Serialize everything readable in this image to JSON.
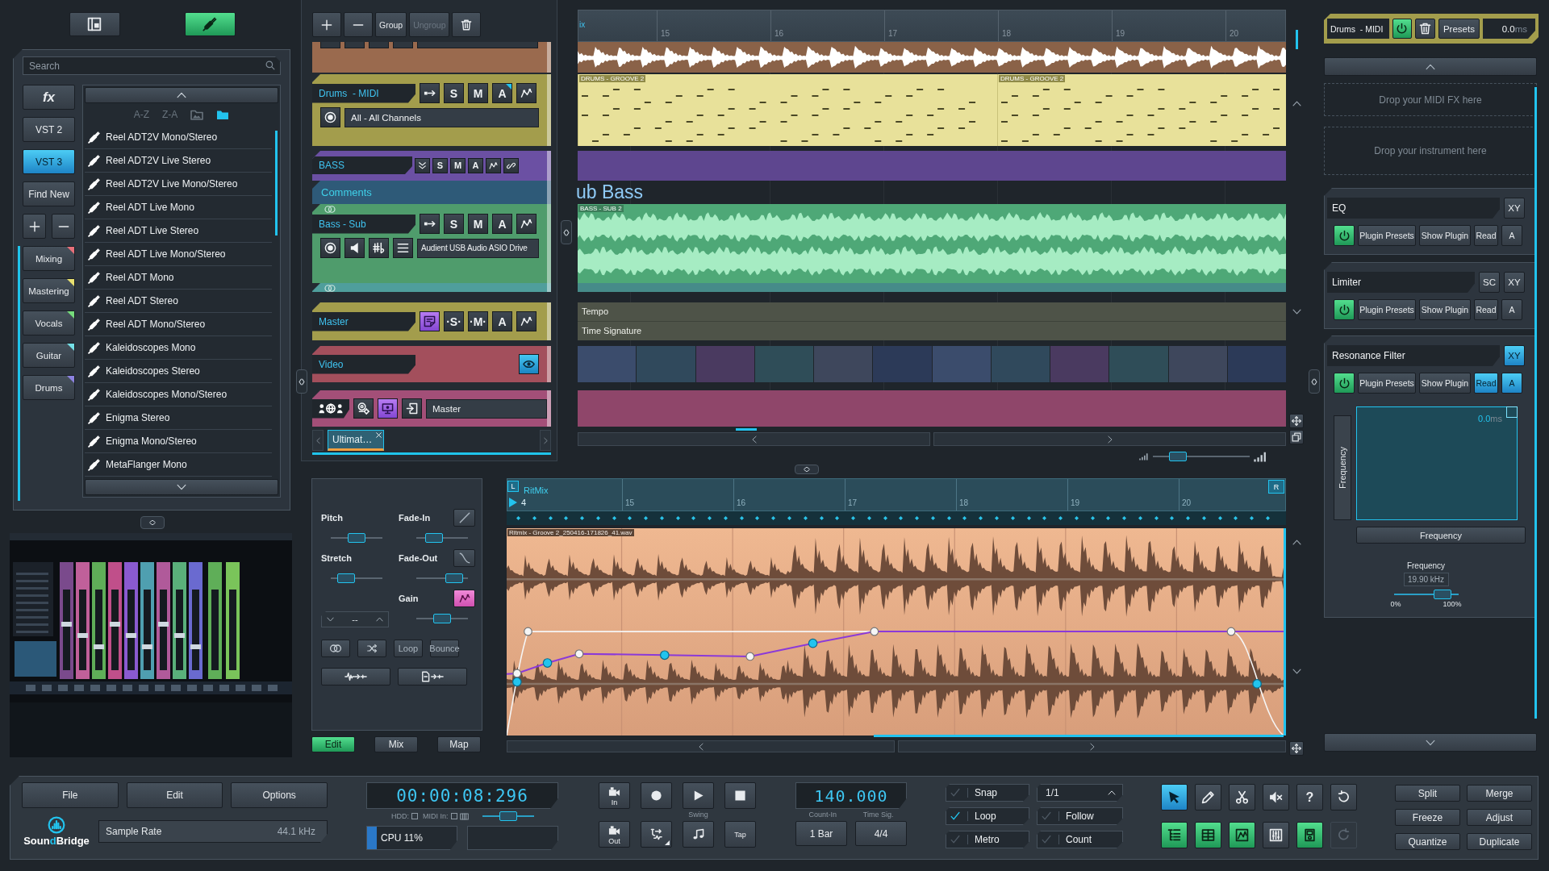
{
  "sidebar": {
    "view_tabs": [
      {
        "kind": "layout",
        "selected": false
      },
      {
        "kind": "plugins",
        "selected": true
      }
    ],
    "search": {
      "placeholder": "Search"
    },
    "formats": [
      {
        "kind": "fx",
        "label": "fx",
        "selected": false
      },
      {
        "kind": "text",
        "label": "VST 2",
        "selected": false
      },
      {
        "kind": "text",
        "label": "VST 3",
        "selected": true
      },
      {
        "kind": "text",
        "label": "Find New",
        "selected": false
      }
    ],
    "collections": [
      {
        "label": "Mixing",
        "color": "#e8707a"
      },
      {
        "label": "Mastering",
        "color": "#e8e070"
      },
      {
        "label": "Vocals",
        "color": "#76dc7c"
      },
      {
        "label": "Guitar",
        "color": "#74dfe6"
      },
      {
        "label": "Drums",
        "color": "#8c82e0"
      }
    ],
    "sort": [
      {
        "label": "A-Z",
        "selected": false
      },
      {
        "label": "Z-A",
        "selected": false
      }
    ],
    "filters": [
      {
        "selected": false
      },
      {
        "selected": true
      }
    ],
    "plugins": [
      "Reel ADT2V Mono/Stereo",
      "Reel ADT2V Live Stereo",
      "Reel ADT2V Live Mono/Stereo",
      "Reel ADT Live Mono",
      "Reel ADT Live Stereo",
      "Reel ADT Live Mono/Stereo",
      "Reel ADT Mono",
      "Reel ADT Stereo",
      "Reel ADT Mono/Stereo",
      "Kaleidoscopes Mono",
      "Kaleidoscopes Stereo",
      "Kaleidoscopes Mono/Stereo",
      "Enigma Stereo",
      "Enigma Mono/Stereo",
      "MetaFlanger Mono"
    ]
  },
  "tracks_panel": {
    "actions": [
      {
        "label": "Group",
        "disabled": false
      },
      {
        "label": "Ungroup",
        "disabled": true
      }
    ],
    "tracks": [
      {
        "kind": "tail",
        "color": "#9a6a4e"
      },
      {
        "kind": "instrument",
        "name": "Drums  - MIDI",
        "color": "#a39d4c",
        "buttons": [
          {
            "label": "S",
            "marked": false
          },
          {
            "label": "M",
            "marked": false
          },
          {
            "label": "A",
            "marked": true
          }
        ],
        "input": "All - All Channels",
        "lane": {
          "clips": [
            "DRUMS - GROOVE 2",
            "DRUMS - GROOVE 2"
          ]
        }
      },
      {
        "kind": "folder",
        "name": "BASS",
        "color": "#6b50a3",
        "buttons": [
          {
            "label": "S",
            "marked": false
          },
          {
            "label": "M",
            "marked": false
          },
          {
            "label": "A",
            "marked": false
          }
        ]
      },
      {
        "kind": "comment",
        "name": "Comments",
        "color": "#2e5a78",
        "lane": {
          "text": "ub Bass"
        }
      },
      {
        "kind": "audio",
        "name": "Bass - Sub",
        "color": "#4f9c6c",
        "buttons": [
          {
            "label": "S",
            "marked": false
          },
          {
            "label": "M",
            "marked": false
          },
          {
            "label": "A",
            "marked": false
          }
        ],
        "input": "Audient USB Audio ASIO Drive",
        "lane": {
          "clips": [
            "BASS - SUB 2"
          ]
        }
      },
      {
        "kind": "head",
        "color": "#4f9e9c"
      },
      {
        "kind": "master",
        "name": "Master",
        "color": "#a39d4c",
        "toggle_on": true,
        "buttons": [
          {
            "label": "·S·",
            "marked": false
          },
          {
            "label": "·M·",
            "marked": false
          },
          {
            "label": "A",
            "marked": false
          }
        ],
        "lane": {
          "labels": [
            "Tempo",
            "Time Signature"
          ]
        }
      },
      {
        "kind": "video",
        "name": "Video",
        "color": "#a34f5c",
        "toggle_on": true
      },
      {
        "kind": "collab",
        "color": "#a34f78",
        "toggle_on": true,
        "input": "Master"
      }
    ],
    "tabs": [
      {
        "label": "Ultimat…",
        "selected": true
      }
    ]
  },
  "arrangement": {
    "ruler_label": "ix",
    "ruler": [
      "15",
      "16",
      "17",
      "18",
      "19",
      "20"
    ],
    "zoom": {
      "level": 0.2
    }
  },
  "clip_editor": {
    "left_controls": [
      {
        "label": "Pitch",
        "level": 0.5
      },
      {
        "label": "Stretch",
        "level": 0.2
      }
    ],
    "right_controls": [
      {
        "label": "Fade-In",
        "kind": "fade-in",
        "active": false,
        "level": 0.25
      },
      {
        "label": "Fade-Out",
        "kind": "fade-out",
        "active": false,
        "level": 0.85
      },
      {
        "label": "Gain",
        "kind": "gain",
        "active": true,
        "level": 0.5
      }
    ],
    "mode": "--",
    "buttons": [
      "Loop",
      "Bounce"
    ],
    "tabs": [
      {
        "label": "Edit",
        "selected": true
      },
      {
        "label": "Mix",
        "selected": false
      },
      {
        "label": "Map",
        "selected": false
      }
    ],
    "region": {
      "start_marker": "L",
      "title": "RitMix",
      "bar": "4",
      "end_marker": "R",
      "ruler": [
        "15",
        "16",
        "17",
        "18",
        "19",
        "20"
      ],
      "clip": "Ritmix - Groove 2_250416-171826_41.wav"
    }
  },
  "inspector": {
    "track": "Drums  - MIDI",
    "power": true,
    "presets": "Presets",
    "delay": "0.0",
    "delay_unit": "ms",
    "drop_zones": [
      "Drop your MIDI FX here",
      "Drop your instrument here"
    ],
    "plugins": [
      {
        "name": "EQ",
        "on": true,
        "toggles": [
          {
            "label": "XY",
            "selected": false
          }
        ],
        "actions": [
          {
            "label": "Plugin Presets",
            "selected": false
          },
          {
            "label": "Show Plugin",
            "selected": false
          },
          {
            "label": "Read",
            "selected": false
          },
          {
            "label": "A",
            "selected": false
          }
        ]
      },
      {
        "name": "Limiter",
        "on": true,
        "toggles": [
          {
            "label": "SC",
            "selected": false
          },
          {
            "label": "XY",
            "selected": false
          }
        ],
        "actions": [
          {
            "label": "Plugin Presets",
            "selected": false
          },
          {
            "label": "Show Plugin",
            "selected": false
          },
          {
            "label": "Read",
            "selected": false
          },
          {
            "label": "A",
            "selected": false
          }
        ]
      },
      {
        "name": "Resonance Filter",
        "on": true,
        "toggles": [
          {
            "label": "XY",
            "selected": true
          }
        ],
        "actions": [
          {
            "label": "Plugin Presets",
            "selected": false
          },
          {
            "label": "Show Plugin",
            "selected": false
          },
          {
            "label": "Read",
            "selected": true
          },
          {
            "label": "A",
            "selected": true
          }
        ],
        "xy_pad": {
          "y_label": "Frequency",
          "x_label": "Frequency",
          "readout": "0.0",
          "readout_unit": "ms"
        },
        "parameter": {
          "label": "Frequency",
          "value": "19.90 kHz",
          "level": 0.85,
          "min_label": "0%",
          "max_label": "100%"
        }
      }
    ]
  },
  "transport": {
    "menu": [
      "File",
      "Edit",
      "Options"
    ],
    "logo": [
      "Soun",
      "d",
      "Bridge"
    ],
    "sample_rate": {
      "label": "Sample Rate",
      "value": "44.1 kHz"
    },
    "time": "00:00:08:296",
    "meters": [
      {
        "kind": "hdd",
        "label": "HDD:"
      },
      {
        "kind": "midi",
        "label": "MIDI In:"
      }
    ],
    "position": {
      "level": 0.5
    },
    "cpu": {
      "label": "CPU 11%",
      "level": 0.11
    },
    "ports": [
      "In",
      "Out"
    ],
    "swing": "Swing",
    "tap": "Tap",
    "tempo": "140.000",
    "count_in": {
      "label": "Count-In",
      "value": "1 Bar"
    },
    "time_sig": {
      "label": "Time Sig.",
      "value": "4/4"
    },
    "toggles": [
      {
        "label": "Snap",
        "checked": false
      },
      {
        "label": "Loop",
        "checked": true
      },
      {
        "label": "Metro",
        "checked": false
      }
    ],
    "grid": "1/1",
    "toggles2": [
      {
        "label": "Follow",
        "checked": false
      },
      {
        "label": "Count",
        "checked": false
      }
    ],
    "tools": [
      {
        "kind": "pointer",
        "selected": true
      },
      {
        "kind": "pencil",
        "selected": false
      },
      {
        "kind": "scissors",
        "selected": false
      },
      {
        "kind": "mute",
        "selected": false
      },
      {
        "kind": "help",
        "label": "?",
        "selected": false
      },
      {
        "kind": "undo",
        "selected": false
      }
    ],
    "views": [
      {
        "kind": "list",
        "on": true,
        "disabled": false
      },
      {
        "kind": "grid",
        "on": true,
        "disabled": false
      },
      {
        "kind": "automation",
        "on": true,
        "disabled": false
      },
      {
        "kind": "mixer",
        "on": false,
        "disabled": false
      },
      {
        "kind": "module",
        "on": true,
        "disabled": false
      },
      {
        "kind": "redo",
        "on": false,
        "disabled": true
      }
    ],
    "edits": [
      "Split",
      "Merge",
      "Freeze",
      "Adjust",
      "Quantize",
      "Duplicate"
    ]
  }
}
